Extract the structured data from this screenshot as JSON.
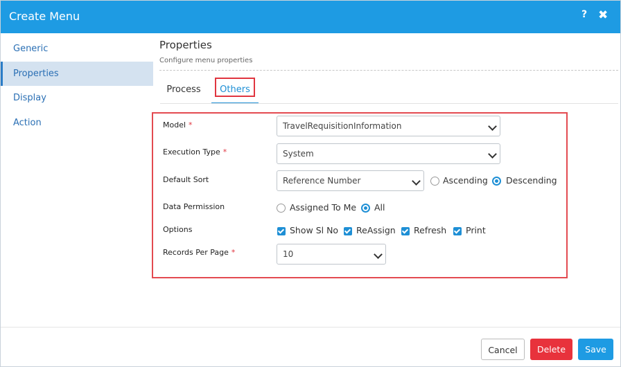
{
  "dialog": {
    "title": "Create Menu",
    "help": "?",
    "close": "✖"
  },
  "sidebar": {
    "items": [
      {
        "label": "Generic"
      },
      {
        "label": "Properties",
        "active": true
      },
      {
        "label": "Display"
      },
      {
        "label": "Action"
      }
    ]
  },
  "section": {
    "title": "Properties",
    "subtitle": "Configure menu properties"
  },
  "tabs": [
    {
      "label": "Process"
    },
    {
      "label": "Others",
      "active": true
    }
  ],
  "form": {
    "model": {
      "label": "Model",
      "required": "*",
      "value": "TravelRequisitionInformation"
    },
    "execution_type": {
      "label": "Execution Type",
      "required": "*",
      "value": "System"
    },
    "default_sort": {
      "label": "Default Sort",
      "value": "Reference Number",
      "ascending": "Ascending",
      "descending": "Descending",
      "selected": "Descending"
    },
    "data_permission": {
      "label": "Data Permission",
      "assigned": "Assigned To Me",
      "all": "All",
      "selected": "All"
    },
    "options": {
      "label": "Options",
      "items": [
        {
          "label": "Show Sl No",
          "checked": true
        },
        {
          "label": "ReAssign",
          "checked": true
        },
        {
          "label": "Refresh",
          "checked": true
        },
        {
          "label": "Print",
          "checked": true
        }
      ]
    },
    "records_per_page": {
      "label": "Records Per Page",
      "required": "*",
      "value": "10"
    }
  },
  "footer": {
    "cancel": "Cancel",
    "delete": "Delete",
    "save": "Save"
  },
  "colors": {
    "header": "#1e9be3",
    "accent": "#1e8fd5",
    "delete": "#e8323c",
    "highlight": "#e34a50"
  }
}
